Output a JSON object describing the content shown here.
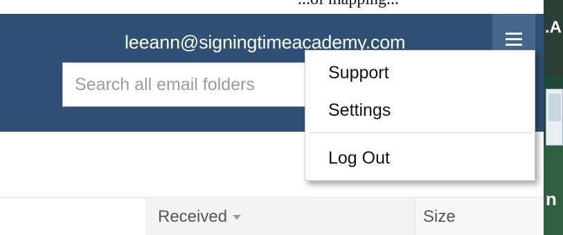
{
  "top_strip": {
    "text": "...of mapping..."
  },
  "header": {
    "user_email": "leeann@signingtimeacademy.com",
    "menu_icon": "hamburger-menu-icon",
    "search": {
      "placeholder": "Search all email folders"
    }
  },
  "dropdown": {
    "items": [
      {
        "label": "Support"
      },
      {
        "label": "Settings"
      },
      {
        "label": "Log Out"
      }
    ]
  },
  "columns": {
    "received": {
      "label": "Received",
      "sort_icon": "caret-down-icon"
    },
    "size": {
      "label": "Size"
    }
  },
  "background_window": {
    "top_text": ".A",
    "bottom_text": "n"
  },
  "colors": {
    "header_bg": "#2f4f74",
    "menu_button_bg": "#456789",
    "text_dark": "#111111",
    "placeholder": "#9b9b9b"
  }
}
